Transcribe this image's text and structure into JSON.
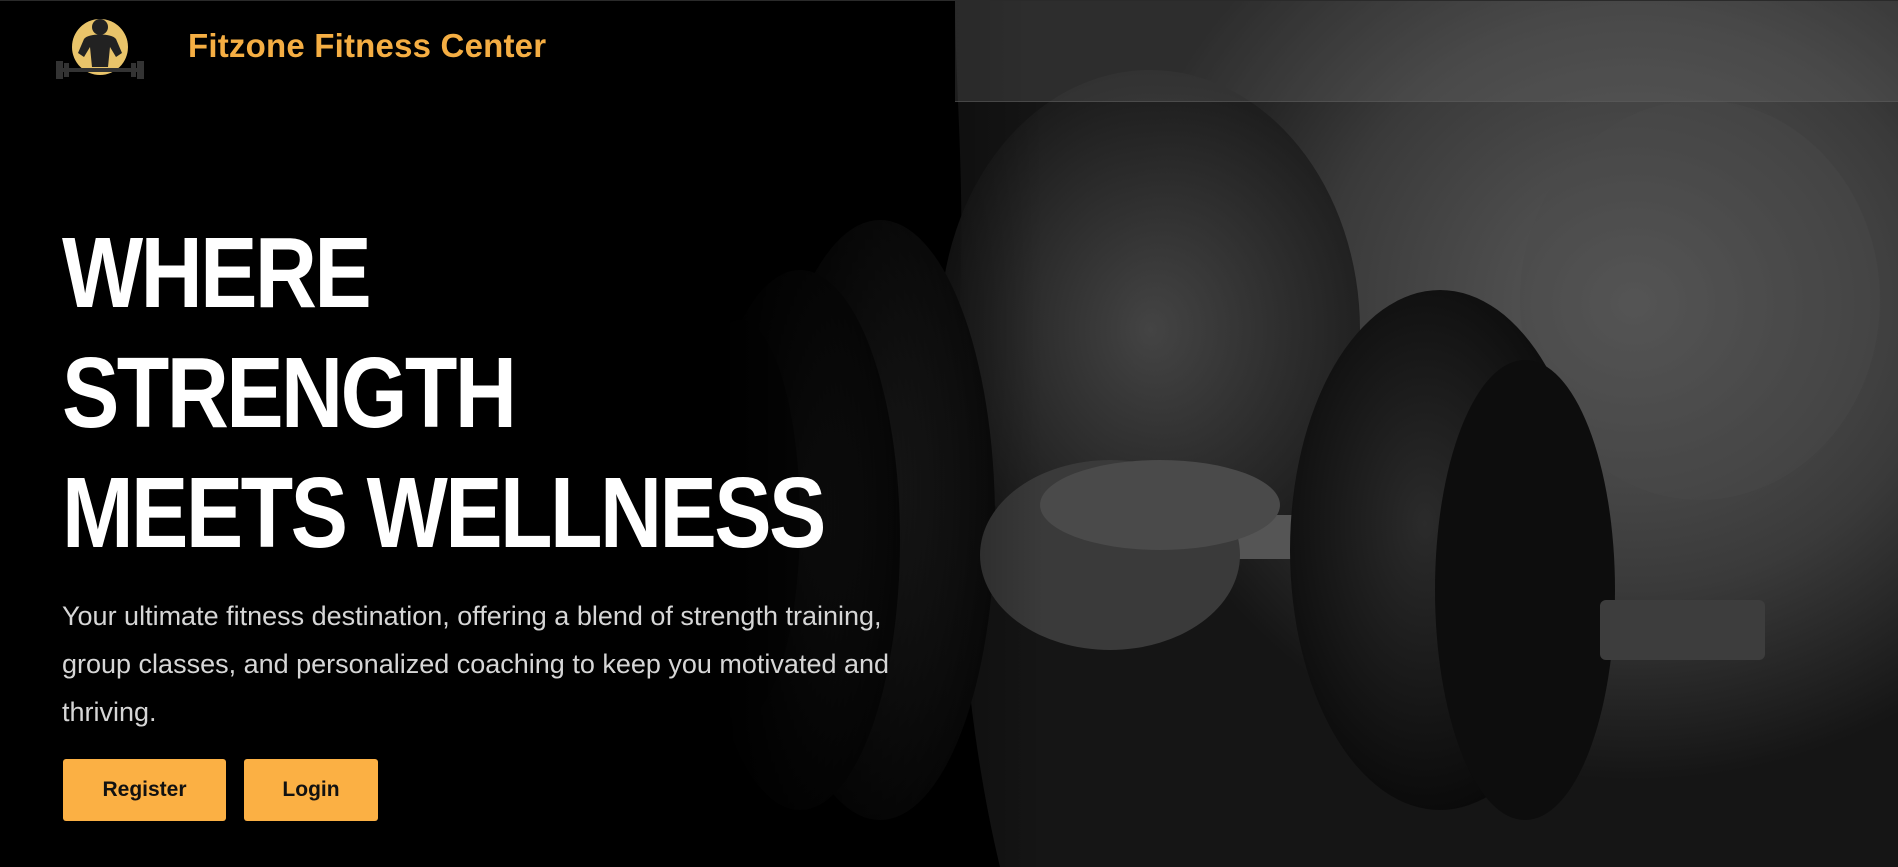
{
  "header": {
    "brand_name": "Fitzone Fitness Center",
    "logo_icon": "bodybuilder-barbell-logo-icon"
  },
  "hero": {
    "headline_lines": [
      "WHERE",
      "STRENGTH",
      "MEETS WELLNESS"
    ],
    "subtitle": "Your ultimate fitness destination, offering a blend of strength training, group classes, and personalized coaching to keep you motivated and thriving.",
    "background": "dumbbell-arm-photo"
  },
  "actions": {
    "register_label": "Register",
    "login_label": "Login"
  },
  "colors": {
    "accent": "#f5ae43",
    "button": "#fbb044",
    "background": "#000000",
    "headline": "#ffffff"
  }
}
